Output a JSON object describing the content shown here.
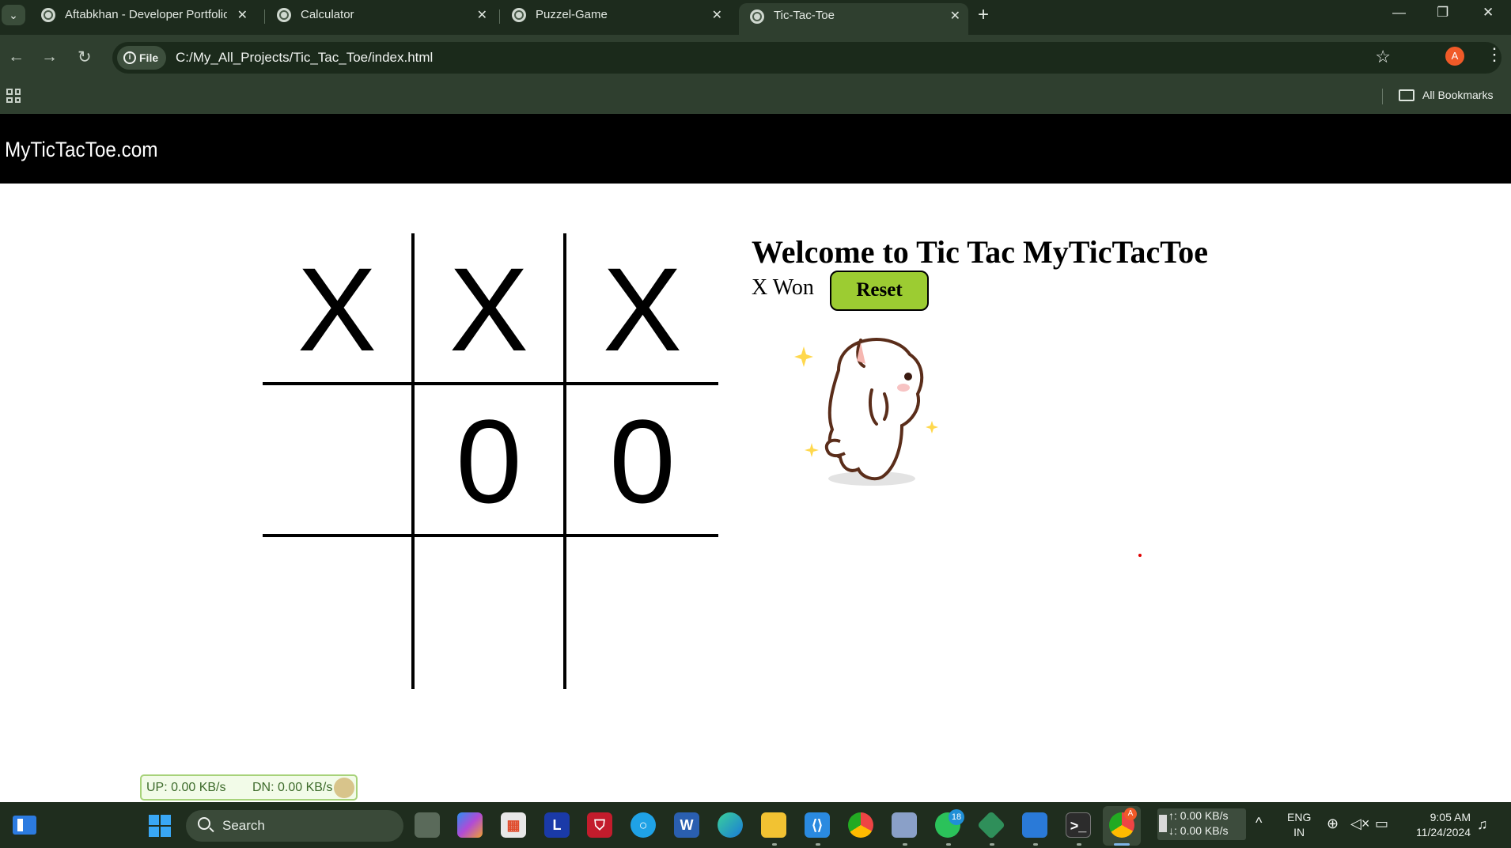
{
  "browser": {
    "tabs": [
      {
        "title": "Aftabkhan - Developer Portfolio",
        "active": false
      },
      {
        "title": "Calculator",
        "active": false
      },
      {
        "title": "Puzzel-Game",
        "active": false
      },
      {
        "title": "Tic-Tac-Toe",
        "active": true
      }
    ],
    "address": {
      "chip": "File",
      "url": "C:/My_All_Projects/Tic_Tac_Toe/index.html"
    },
    "profile_initial": "A",
    "bookmarks_label": "All Bookmarks"
  },
  "page": {
    "brand": "MyTicTacToe.com",
    "welcome": "Welcome to Tic Tac MyTicTacToe",
    "status": "X Won",
    "reset_label": "Reset",
    "board": [
      "X",
      "X",
      "X",
      "",
      "0",
      "0",
      "",
      "",
      ""
    ]
  },
  "net_widget": {
    "up": "UP: 0.00 KB/s",
    "down": "DN: 0.00 KB/s"
  },
  "taskbar": {
    "search_label": "Search",
    "whatsapp_badge": "18",
    "chrome_badge": "A",
    "net_up": "↑: 0.00 KB/s",
    "net_down": "↓: 0.00 KB/s",
    "lang_line1": "ENG",
    "lang_line2": "IN",
    "time": "9:05 AM",
    "date": "11/24/2024"
  },
  "colors": {
    "tab_strip": "#1d2b1d",
    "toolbar": "#2f3f2f",
    "nav_bar": "#000000",
    "reset_button": "#9ccc32",
    "taskbar": "#1f2d1e"
  }
}
